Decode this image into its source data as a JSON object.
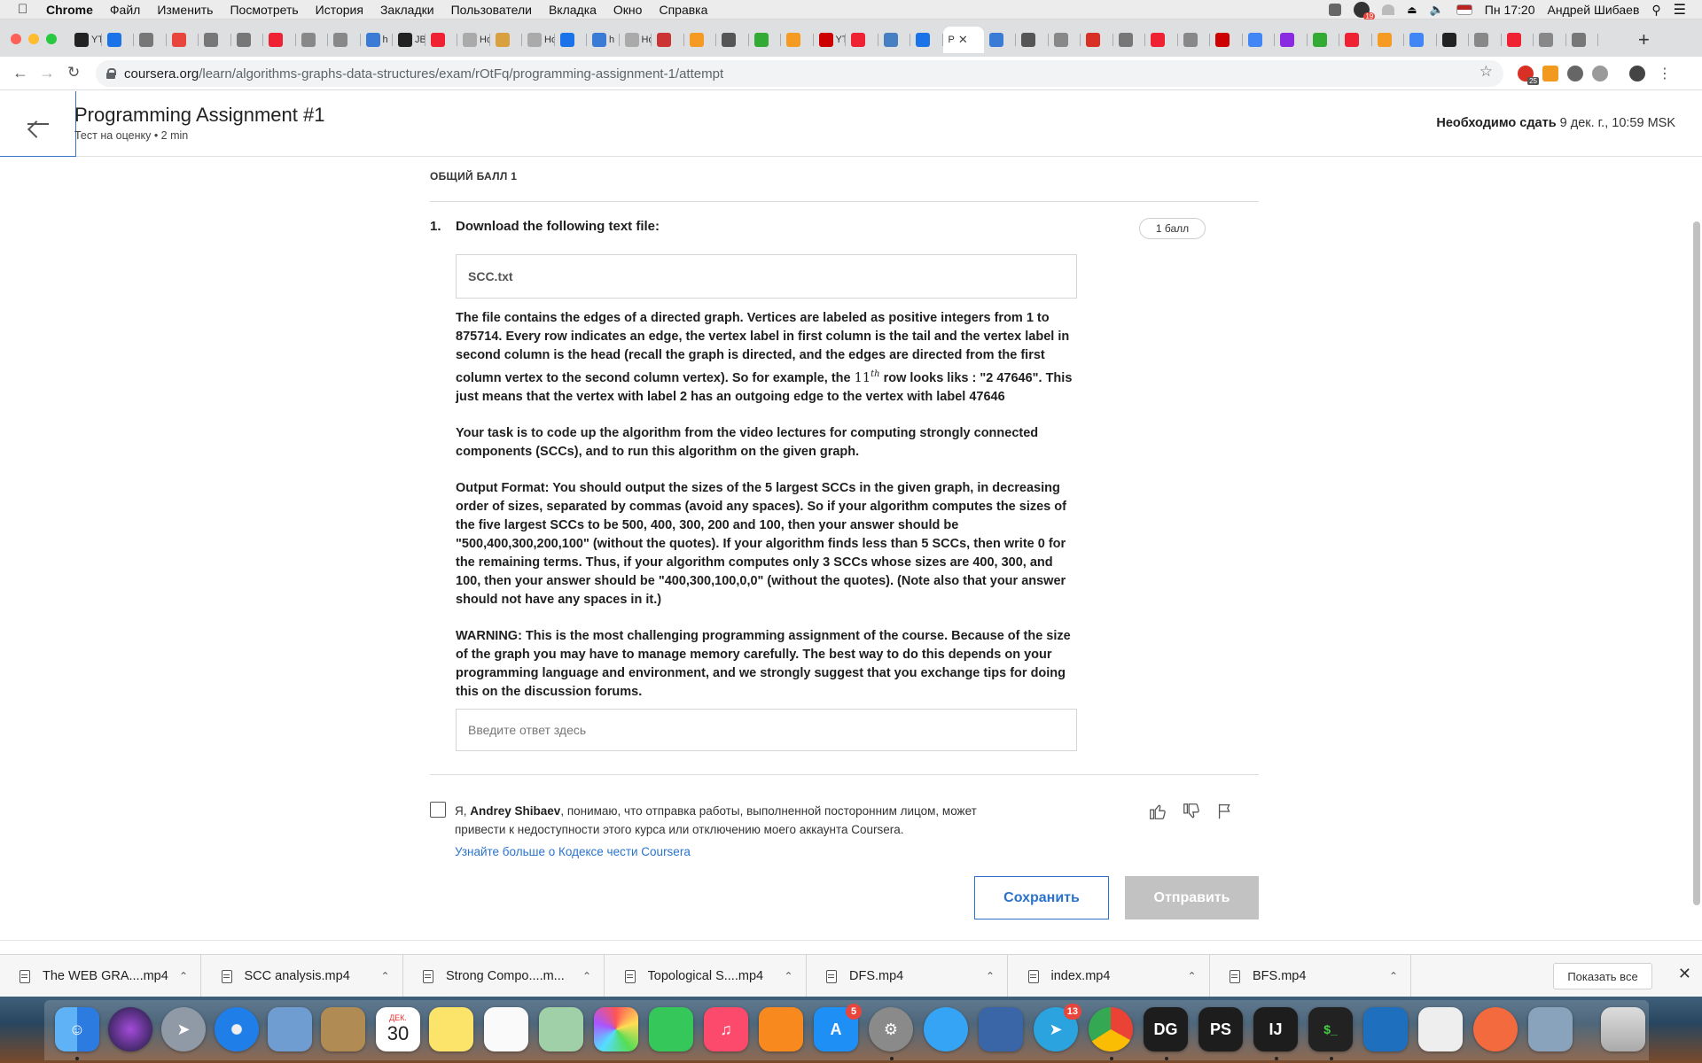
{
  "menubar": {
    "app": "Chrome",
    "items": [
      "Файл",
      "Изменить",
      "Посмотреть",
      "История",
      "Закладки",
      "Пользователи",
      "Вкладка",
      "Окно",
      "Справка"
    ],
    "clock": "Пн 17:20",
    "user": "Андрей Шибаев",
    "notification_count": "19"
  },
  "tabs": {
    "labels": [
      "YT",
      "",
      "",
      "",
      "",
      "",
      "",
      "",
      "",
      "h",
      "JB",
      "",
      "Нов",
      "",
      "Нов",
      "",
      "h",
      "Нов",
      "",
      "",
      "",
      "",
      "",
      "YT",
      "",
      "",
      "",
      "",
      "",
      "",
      "",
      "",
      "",
      "",
      "",
      "",
      "",
      "",
      "",
      "",
      "",
      "",
      "",
      "",
      "",
      ""
    ],
    "active_label": "P"
  },
  "browser": {
    "url_host": "coursera.org",
    "url_path": "/learn/algorithms-graphs-data-structures/exam/rOtFq/programming-assignment-1/attempt",
    "ext_badge": "25"
  },
  "header": {
    "title": "Programming Assignment #1",
    "subtitle": "Тест на оценку • 2 min",
    "due_label": "Необходимо сдать",
    "due_value": "9 дек. г., 10:59 MSK"
  },
  "content": {
    "score": "ОБЩИЙ БАЛЛ 1",
    "question_number": "1.",
    "question_title": "Download the following text file:",
    "points": "1 балл",
    "file_name": "SCC.txt",
    "para1_before": "The file contains the edges of a directed graph. Vertices are labeled as positive integers from 1 to 875714. Every row indicates an edge, the vertex label in first column is the tail and the vertex label in second column is the head (recall the graph is directed, and the edges are directed from the first column vertex to the second column vertex). So for example, the ",
    "para1_math_base": "11",
    "para1_math_sup": "th",
    "para1_after": " row looks liks : \"2 47646\". This just means that the vertex with label 2 has an outgoing edge to the vertex with label 47646",
    "para2": "Your task is to code up the algorithm from the video lectures for computing strongly connected components (SCCs), and to run this algorithm on the given graph.",
    "para3": "Output Format: You should output the sizes of the 5 largest SCCs in the given graph, in decreasing order of sizes, separated by commas (avoid any spaces). So if your algorithm computes the sizes of the five largest SCCs to be 500, 400, 300, 200 and 100, then your answer should be \"500,400,300,200,100\" (without the quotes). If your algorithm finds less than 5 SCCs, then write 0 for the remaining terms. Thus, if your algorithm computes only 3 SCCs whose sizes are 400, 300, and 100, then your answer should be \"400,300,100,0,0\" (without the quotes). (Note also that your answer should not have any spaces in it.)",
    "para4": "WARNING: This is the most challenging programming assignment of the course. Because of the size of the graph you may have to manage memory carefully. The best way to do this depends on your programming language and environment, and we strongly suggest that you exchange tips for doing this on the discussion forums.",
    "answer_placeholder": "Введите ответ здесь"
  },
  "honor": {
    "prefix": "Я, ",
    "name": "Andrey Shibaev",
    "text": ", понимаю, что отправка работы, выполненной посторонним лицом, может привести к недоступности этого курса или отключению моего аккаунта Coursera.",
    "link": "Узнайте больше о Кодексе чести Coursera"
  },
  "buttons": {
    "save": "Сохранить",
    "submit": "Отправить"
  },
  "downloads": {
    "items": [
      "The WEB GRA....mp4",
      "SCC analysis.mp4",
      "Strong Compo....m...",
      "Topological S....mp4",
      "DFS.mp4",
      "index.mp4",
      "BFS.mp4"
    ],
    "show_all": "Показать все"
  },
  "dock": {
    "calendar_month": "ДЕК.",
    "calendar_day": "30",
    "appstore_badge": "5",
    "telegram_badge": "13",
    "datagrip": "DG",
    "phpstorm": "PS",
    "intellij": "IJ"
  },
  "colors": {
    "link_blue": "#2a73cc",
    "disabled_button": "#c2c2c2",
    "chrome_tabstrip": "#dedfe1"
  }
}
